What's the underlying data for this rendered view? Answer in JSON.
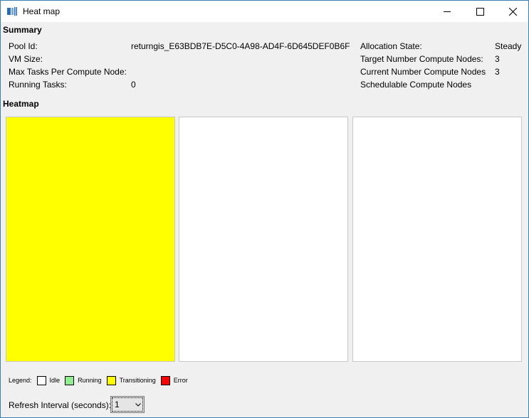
{
  "window": {
    "title": "Heat map"
  },
  "summary": {
    "header": "Summary",
    "pool_id_label": "Pool Id:",
    "pool_id_value": "returngis_E63BDB7E-D5C0-4A98-AD4F-6D645DEF0B6F",
    "vm_size_label": "VM Size:",
    "vm_size_value": "",
    "max_tasks_label": "Max Tasks Per Compute Node:",
    "max_tasks_value": "",
    "running_tasks_label": "Running Tasks:",
    "running_tasks_value": "0",
    "allocation_state_label": "Allocation State:",
    "allocation_state_value": "Steady",
    "target_nodes_label": "Target Number Compute Nodes:",
    "target_nodes_value": "3",
    "current_nodes_label": "Current Number Compute Nodes",
    "current_nodes_value": "3",
    "schedulable_nodes_label": "Schedulable Compute Nodes",
    "schedulable_nodes_value": ""
  },
  "heatmap": {
    "header": "Heatmap",
    "nodes": [
      {
        "state": "Transitioning",
        "color": "#ffff00"
      },
      {
        "state": "Idle",
        "color": "#ffffff"
      },
      {
        "state": "Idle",
        "color": "#ffffff"
      }
    ]
  },
  "legend": {
    "title": "Legend:",
    "items": [
      {
        "label": "Idle",
        "color": "#ffffff"
      },
      {
        "label": "Running",
        "color": "#90ee90"
      },
      {
        "label": "Transitioning",
        "color": "#ffff00"
      },
      {
        "label": "Error",
        "color": "#ff0000"
      }
    ]
  },
  "refresh": {
    "label": "Refresh Interval (seconds):",
    "value": "1"
  }
}
